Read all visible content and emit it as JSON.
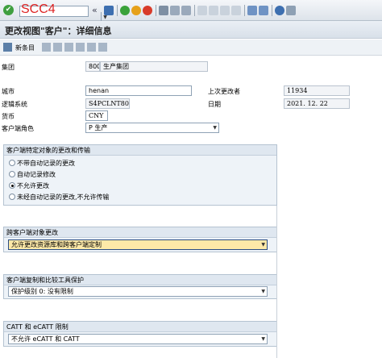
{
  "toolbar": {
    "command_value": "",
    "command_overlay": "SCC4",
    "ok_glyph": "✔",
    "history_glyph": "«",
    "icons": [
      "save-icon",
      "back-icon",
      "exit-icon",
      "cancel-icon",
      "print-icon",
      "find-icon",
      "find-next-icon",
      "first-page-icon",
      "previous-page-icon",
      "next-page-icon",
      "last-page-icon",
      "new-session-icon",
      "shortcut-icon",
      "help-icon",
      "customize-layout-icon"
    ]
  },
  "title": "更改视图\"客户\"：详细信息",
  "app_toolbar": {
    "new_entries_label": "新条目",
    "icons": [
      "change-display-icon",
      "copy-icon",
      "delete-icon",
      "undo-icon",
      "previous-entry-icon",
      "next-entry-icon",
      "transport-icon"
    ]
  },
  "fields": {
    "client_label": "集团",
    "client_value": "800",
    "client_desc": "生产集团",
    "city_label": "城市",
    "city_value": "henan",
    "last_changed_by_label": "上次更改者",
    "last_changed_by_value": "11934",
    "logical_system_label": "逻辑系统",
    "logical_system_value": "S4PCLNT800",
    "date_label": "日期",
    "date_value": "2021. 12. 22",
    "currency_label": "货币",
    "currency_value": "CNY",
    "client_role_label": "客户端角色",
    "client_role_value": "P 生产"
  },
  "group_changes": {
    "title": "客户端特定对象的更改和传输",
    "options": [
      {
        "label": "不带自动记录的更改",
        "selected": false
      },
      {
        "label": "自动记录修改",
        "selected": false
      },
      {
        "label": "不允许更改",
        "selected": true
      },
      {
        "label": "未经自动记录的更改,不允许传输",
        "selected": false
      }
    ]
  },
  "group_cross_client": {
    "title": "跨客户端对象更改",
    "value": "允许更改资源库和跨客户端定制"
  },
  "group_protection": {
    "title": "客户端复制和比较工具保护",
    "value": "保护级别 0: 没有限制"
  },
  "group_catt": {
    "title": "CATT 和 eCATT 限制",
    "value": "不允许 eCATT 和 CATT"
  },
  "colors": {
    "title_bg": "#dfe6ee",
    "group_bg": "#eef3f8",
    "highlight_field": "#fde9a8",
    "overlay_red": "#d22222"
  }
}
